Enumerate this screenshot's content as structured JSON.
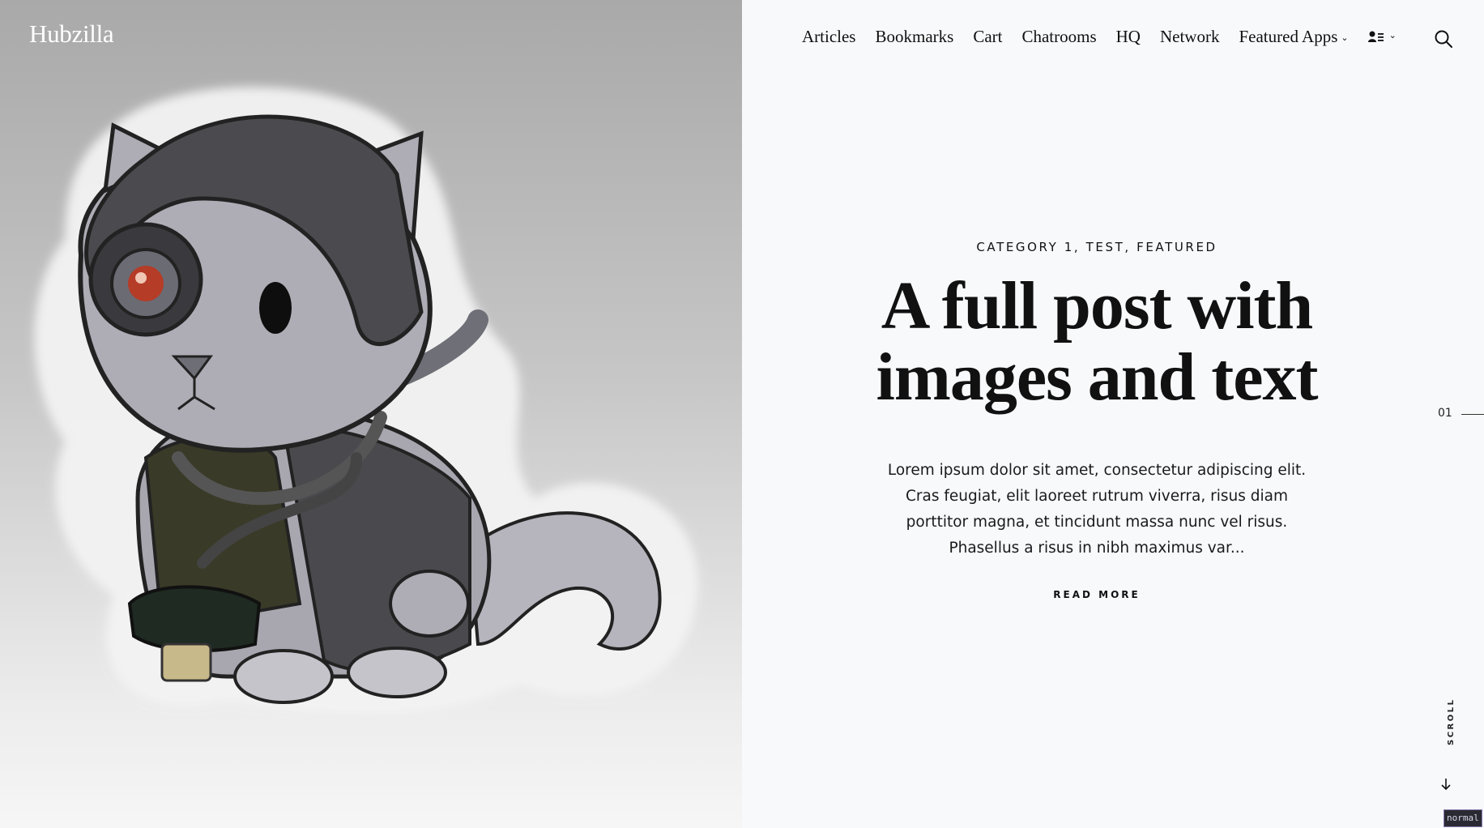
{
  "site": {
    "title": "Hubzilla"
  },
  "nav": {
    "items": [
      "Articles",
      "Bookmarks",
      "Cart",
      "Chatrooms",
      "HQ",
      "Network"
    ],
    "featured_apps": "Featured Apps",
    "user_icon": "user-list-icon",
    "search_icon": "search-icon"
  },
  "hero": {
    "illustration": "cat-in-robot-helmet-sticker"
  },
  "post": {
    "categories": "CATEGORY 1, TEST, FEATURED",
    "title": "A full post with images and text",
    "excerpt": "Lorem ipsum dolor sit amet, consectetur adipiscing elit. Cras feugiat, elit laoreet rutrum viverra, risus diam porttitor magna, et tincidunt massa nunc vel risus. Phasellus a risus in nibh maximus var...",
    "read_more": "READ MORE"
  },
  "slider": {
    "current": "01"
  },
  "scroll": {
    "label": "SCROLL"
  },
  "badge": {
    "text": "normal"
  },
  "colors": {
    "background": "#f8f9fb",
    "text": "#111111",
    "hero_top": "#a9a9a9",
    "hero_bottom": "#f6f6f6"
  }
}
